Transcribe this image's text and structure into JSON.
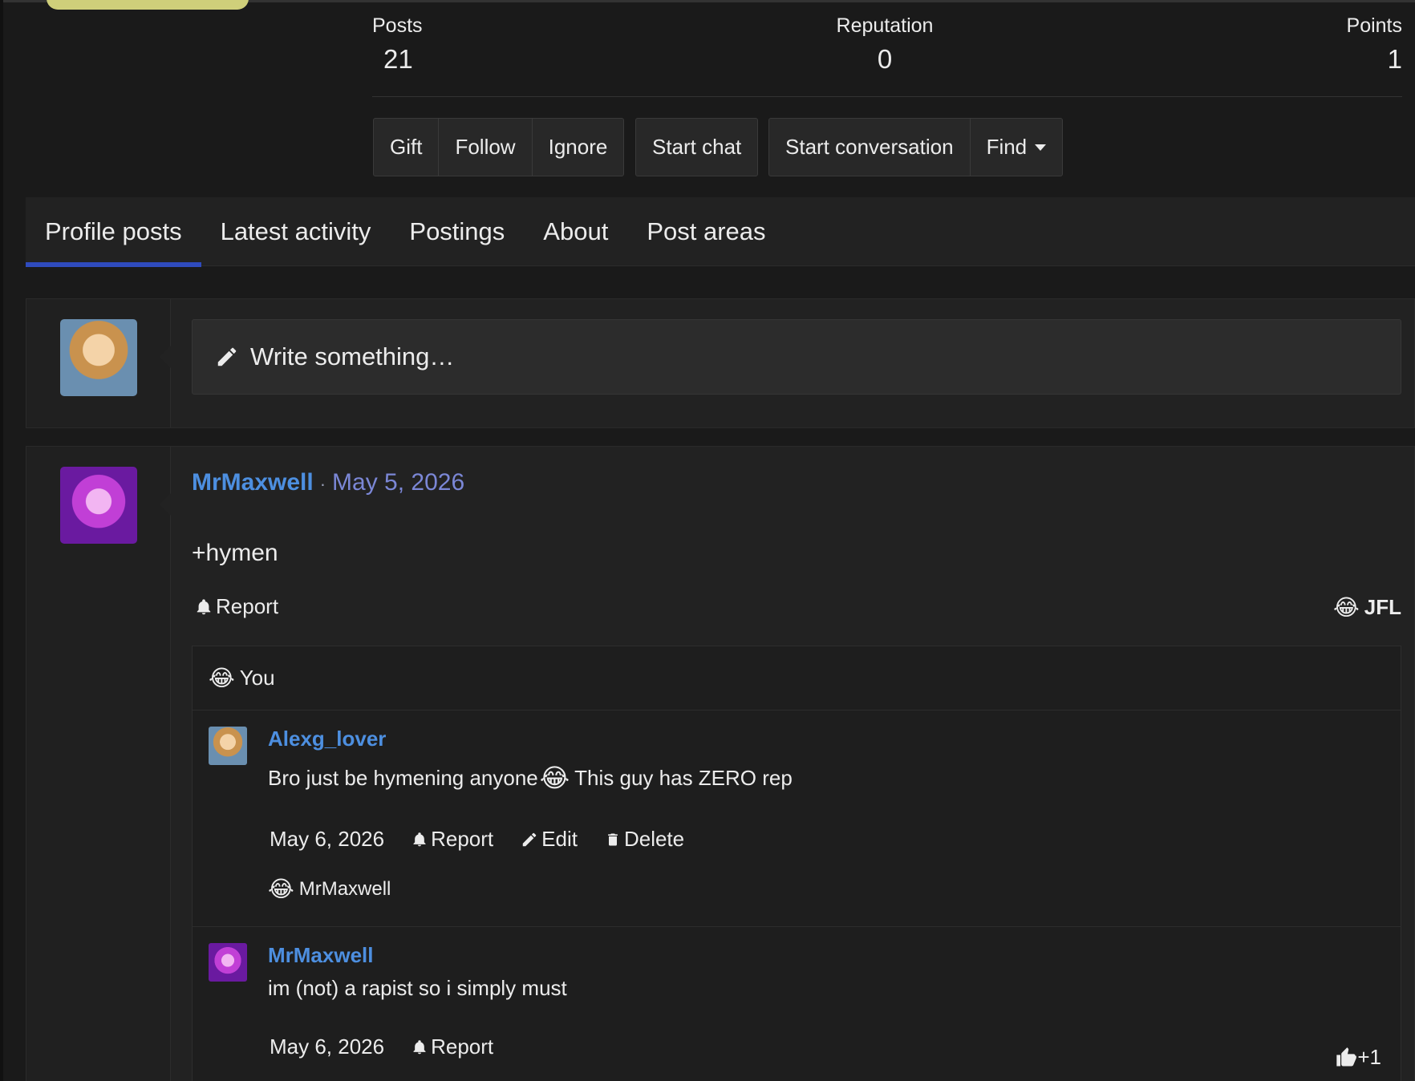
{
  "stats": {
    "posts_label": "Posts",
    "posts_value": "21",
    "reputation_label": "Reputation",
    "reputation_value": "0",
    "points_label": "Points",
    "points_value": "1"
  },
  "actions": {
    "gift": "Gift",
    "follow": "Follow",
    "ignore": "Ignore",
    "start_chat": "Start chat",
    "start_conversation": "Start conversation",
    "find": "Find"
  },
  "tabs": [
    "Profile posts",
    "Latest activity",
    "Postings",
    "About",
    "Post areas"
  ],
  "composer": {
    "placeholder": "Write something…",
    "icon": "pencil-icon"
  },
  "post": {
    "author": "MrMaxwell",
    "separator": "·",
    "date": "May 5, 2026",
    "body": "+hymen",
    "report_label": "Report",
    "reaction_emoji": "😂",
    "reaction_label": "JFL",
    "reactors_emoji": "😂",
    "reactors_label": "You"
  },
  "comments": [
    {
      "author": "Alexg_lover",
      "body_before": "Bro just be hymening anyone",
      "emoji": "😂",
      "body_after": " This guy has ZERO rep",
      "date": "May 6, 2026",
      "report": "Report",
      "edit": "Edit",
      "delete": "Delete",
      "reactors_emoji": "😂",
      "reactors": "MrMaxwell"
    },
    {
      "author": "MrMaxwell",
      "body": "im (not) a rapist so i simply must",
      "date": "May 6, 2026",
      "report": "Report",
      "likes": "+1"
    }
  ],
  "colors": {
    "accent_tab": "#2f4bbd",
    "link": "#4d8fe0",
    "date_link": "#7b87d6",
    "background": "#1a1a1a"
  }
}
